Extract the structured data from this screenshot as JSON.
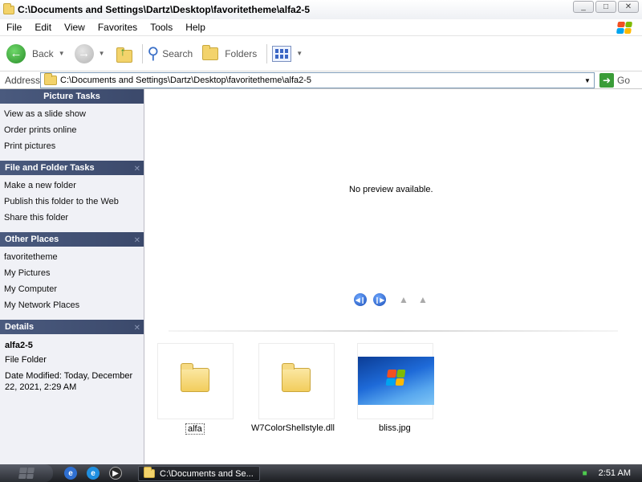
{
  "window": {
    "title": "C:\\Documents and Settings\\Dartz\\Desktop\\favoritetheme\\alfa2-5",
    "controls": [
      "_",
      "□",
      "✕"
    ]
  },
  "menu": {
    "items": [
      "File",
      "Edit",
      "View",
      "Favorites",
      "Tools",
      "Help"
    ]
  },
  "toolbar": {
    "back_label": "Back",
    "search_label": "Search",
    "folders_label": "Folders"
  },
  "address": {
    "label": "Address",
    "value": "C:\\Documents and Settings\\Dartz\\Desktop\\favoritetheme\\alfa2-5",
    "go_label": "Go"
  },
  "taskpane": {
    "picture_tasks": {
      "header": "Picture Tasks",
      "links": [
        "View as a slide show",
        "Order prints online",
        "Print pictures"
      ]
    },
    "file_folder_tasks": {
      "header": "File and Folder Tasks",
      "links": [
        "Make a new folder",
        "Publish this folder to the Web",
        "Share this folder"
      ]
    },
    "other_places": {
      "header": "Other Places",
      "links": [
        "favoritetheme",
        "My Pictures",
        "My Computer",
        "My Network Places"
      ]
    },
    "details": {
      "header": "Details",
      "name": "alfa2-5",
      "type": "File Folder",
      "modified": "Date Modified: Today, December 22, 2021, 2:29 AM"
    }
  },
  "preview": {
    "message": "No preview available."
  },
  "files": [
    {
      "name": "alfa",
      "type": "folder"
    },
    {
      "name": "W7ColorShellstyle.dll",
      "type": "folder"
    },
    {
      "name": "bliss.jpg",
      "type": "image"
    }
  ],
  "taskbar": {
    "task_label": "C:\\Documents and Se...",
    "clock": "2:51 AM"
  },
  "colors": {
    "xp_red": "#f25022",
    "xp_green": "#7fba00",
    "xp_blue": "#00a4ef",
    "xp_yellow": "#ffb900",
    "pane_header": "#44547a"
  }
}
